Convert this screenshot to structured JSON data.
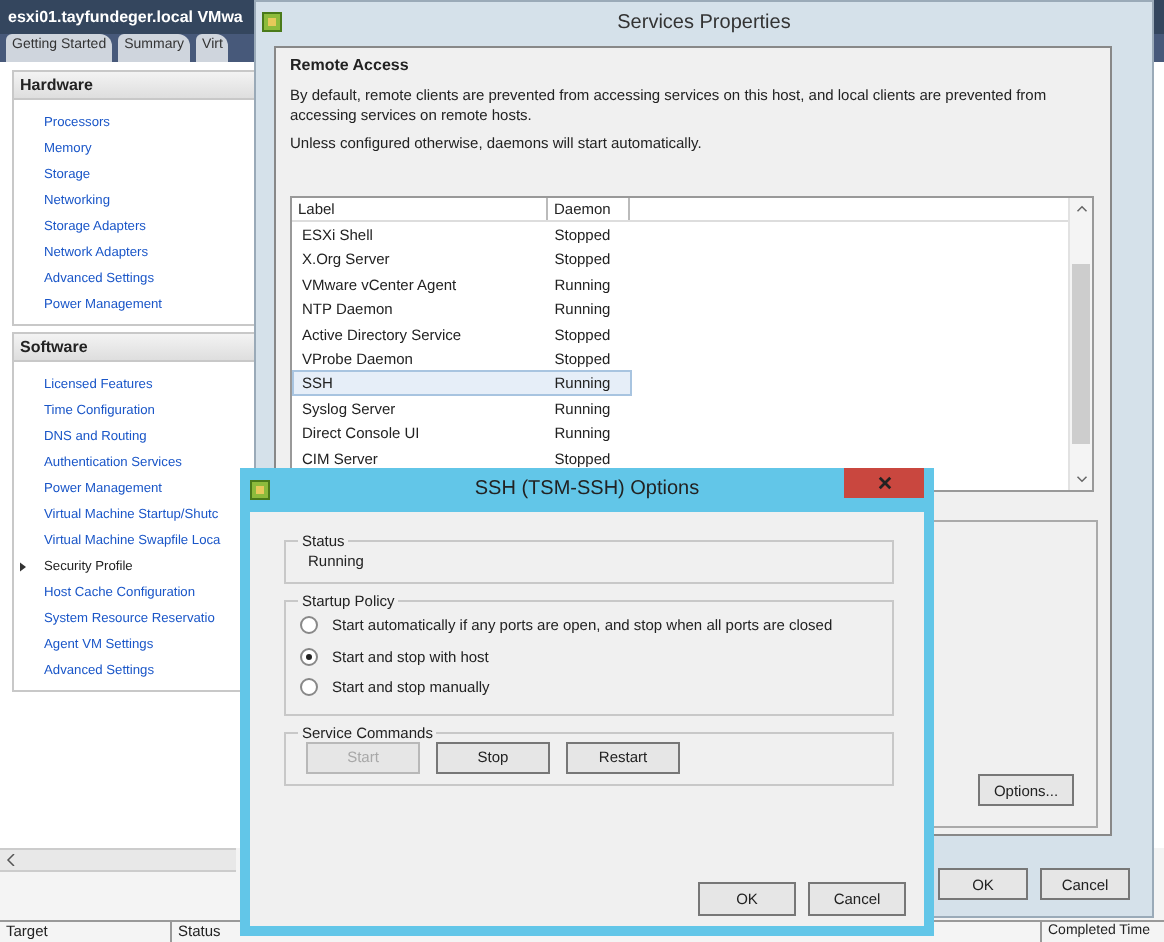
{
  "host_window": {
    "title": "esxi01.tayfundeger.local VMwa",
    "tabs": [
      {
        "label": "Getting Started"
      },
      {
        "label": "Summary"
      },
      {
        "label": "Virt"
      }
    ],
    "panels": [
      {
        "title": "Hardware",
        "items": [
          {
            "label": "Processors",
            "selected": false
          },
          {
            "label": "Memory",
            "selected": false
          },
          {
            "label": "Storage",
            "selected": false
          },
          {
            "label": "Networking",
            "selected": false
          },
          {
            "label": "Storage Adapters",
            "selected": false
          },
          {
            "label": "Network Adapters",
            "selected": false
          },
          {
            "label": "Advanced Settings",
            "selected": false
          },
          {
            "label": "Power Management",
            "selected": false
          }
        ]
      },
      {
        "title": "Software",
        "items": [
          {
            "label": "Licensed Features",
            "selected": false
          },
          {
            "label": "Time Configuration",
            "selected": false
          },
          {
            "label": "DNS and Routing",
            "selected": false
          },
          {
            "label": "Authentication Services",
            "selected": false
          },
          {
            "label": "Power Management",
            "selected": false
          },
          {
            "label": "Virtual Machine Startup/Shutc",
            "selected": false
          },
          {
            "label": "Virtual Machine Swapfile Loca",
            "selected": false
          },
          {
            "label": "Security Profile",
            "selected": true
          },
          {
            "label": "Host Cache Configuration",
            "selected": false
          },
          {
            "label": "System Resource Reservatio",
            "selected": false
          },
          {
            "label": "Agent VM Settings",
            "selected": false
          },
          {
            "label": "Advanced Settings",
            "selected": false
          }
        ]
      }
    ],
    "status_bar": {
      "columns": [
        "Target",
        "Status",
        "Completed Time"
      ]
    }
  },
  "services_window": {
    "title": "Services Properties",
    "section_title": "Remote Access",
    "description": "By default, remote clients are prevented from accessing services on this host, and local clients are prevented from accessing services on remote hosts.",
    "note": "Unless configured otherwise, daemons will start automatically.",
    "columns": [
      "Label",
      "Daemon"
    ],
    "rows": [
      {
        "label": "ESXi Shell",
        "daemon": "Stopped",
        "selected": false
      },
      {
        "label": "X.Org Server",
        "daemon": "Stopped",
        "selected": false
      },
      {
        "label": "VMware vCenter Agent",
        "daemon": "Running",
        "selected": false
      },
      {
        "label": "NTP Daemon",
        "daemon": "Running",
        "selected": false
      },
      {
        "label": "Active Directory Service",
        "daemon": "Stopped",
        "selected": false
      },
      {
        "label": "VProbe Daemon",
        "daemon": "Stopped",
        "selected": false
      },
      {
        "label": "SSH",
        "daemon": "Running",
        "selected": true
      },
      {
        "label": "Syslog Server",
        "daemon": "Running",
        "selected": false
      },
      {
        "label": "Direct Console UI",
        "daemon": "Running",
        "selected": false
      },
      {
        "label": "CIM Server",
        "daemon": "Stopped",
        "selected": false
      }
    ],
    "options_button": "Options...",
    "buttons": [
      "OK",
      "Cancel"
    ]
  },
  "dialog": {
    "title": "SSH (TSM-SSH) Options",
    "status_title": "Status",
    "status": "Running",
    "policy_title": "Startup Policy",
    "policies": [
      {
        "label": "Start automatically if any ports are open, and stop when all ports are closed",
        "selected": false
      },
      {
        "label": "Start and stop with host",
        "selected": true
      },
      {
        "label": "Start and stop manually",
        "selected": false
      }
    ],
    "commands_title": "Service Commands",
    "commands": [
      {
        "label": "Start",
        "disabled": true
      },
      {
        "label": "Stop",
        "disabled": false
      },
      {
        "label": "Restart",
        "disabled": false
      }
    ],
    "buttons": [
      "OK",
      "Cancel"
    ]
  }
}
